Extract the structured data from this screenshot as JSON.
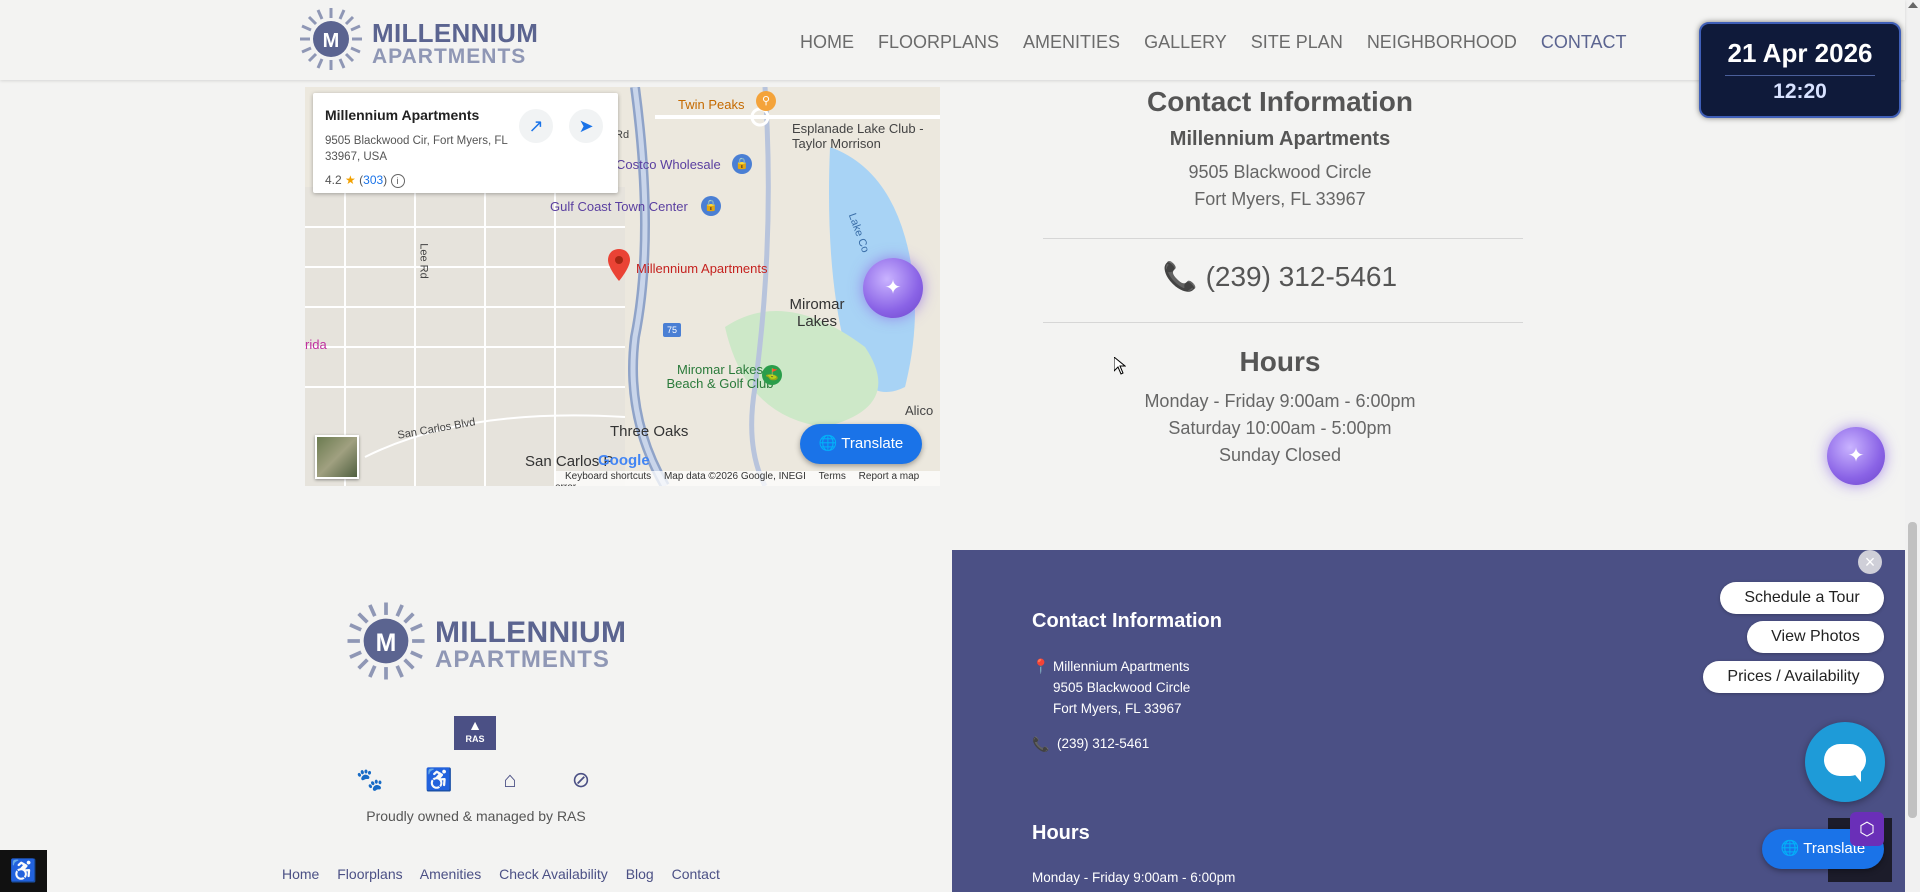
{
  "header": {
    "logo": {
      "line1": "MILLENNIUM",
      "line2": "APARTMENTS"
    },
    "nav": [
      {
        "label": "HOME"
      },
      {
        "label": "FLOORPLANS"
      },
      {
        "label": "AMENITIES"
      },
      {
        "label": "GALLERY"
      },
      {
        "label": "SITE PLAN"
      },
      {
        "label": "NEIGHBORHOOD"
      },
      {
        "label": "CONTACT",
        "active": true
      }
    ]
  },
  "clock": {
    "date": "21 Apr 2026",
    "time": "12:20"
  },
  "map": {
    "card": {
      "title": "Millennium Apartments",
      "address": "9505 Blackwood Cir, Fort Myers, FL 33967, USA",
      "rating": "4.2",
      "reviews": "303"
    },
    "labels": {
      "twin_peaks": "Twin Peaks",
      "esplanade": "Esplanade Lake Club - Taylor Morrison",
      "costco": "Costco Wholesale",
      "gulf_coast": "Gulf Coast Town Center",
      "millennium": "Millennium Apartments",
      "miromar_lakes": "Miromar Lakes",
      "miromar_club": "Miromar Lakes Beach & Golf Club",
      "lee_rd": "Lee Rd",
      "lake_co": "Lake Co",
      "florida": "rida",
      "alico": "Alico",
      "san_carlos_blvd": "San Carlos Blvd",
      "three_oaks": "Three Oaks",
      "san_carlos_park": "San Carlos P",
      "rd": "Rd",
      "i75": "75"
    },
    "footer": {
      "keyboard": "Keyboard shortcuts",
      "data": "Map data ©2026 Google, INEGI",
      "terms": "Terms",
      "report": "Report a map error"
    },
    "google": "Google"
  },
  "translate_label": "Translate",
  "contact": {
    "heading": "Contact Information",
    "name": "Millennium Apartments",
    "address1": "9505 Blackwood Circle",
    "address2": "Fort Myers, FL 33967",
    "phone": "(239) 312-5461"
  },
  "hours": {
    "heading": "Hours",
    "lines": [
      "Monday - Friday 9:00am - 6:00pm",
      "Saturday 10:00am - 5:00pm",
      "Sunday Closed"
    ]
  },
  "footer": {
    "owned": "Proudly owned & managed by RAS",
    "ras_label": "RAS",
    "links": [
      "Home",
      "Floorplans",
      "Amenities",
      "Check Availability",
      "Blog",
      "Contact"
    ],
    "contact_heading": "Contact Information",
    "address_lines": [
      "Millennium Apartments",
      "9505 Blackwood Circle",
      "Fort Myers, FL 33967"
    ],
    "phone": "(239) 312-5461",
    "hours_heading": "Hours",
    "hours_line": "Monday - Friday 9:00am - 6:00pm"
  },
  "cta": {
    "tour": "Schedule a Tour",
    "photos": "View Photos",
    "prices": "Prices / Availability"
  },
  "colors": {
    "brand": "#5b6490",
    "footer_bg": "#4b5085",
    "translate_blue": "#1a73e8",
    "chat_blue": "#1e9bd8"
  }
}
